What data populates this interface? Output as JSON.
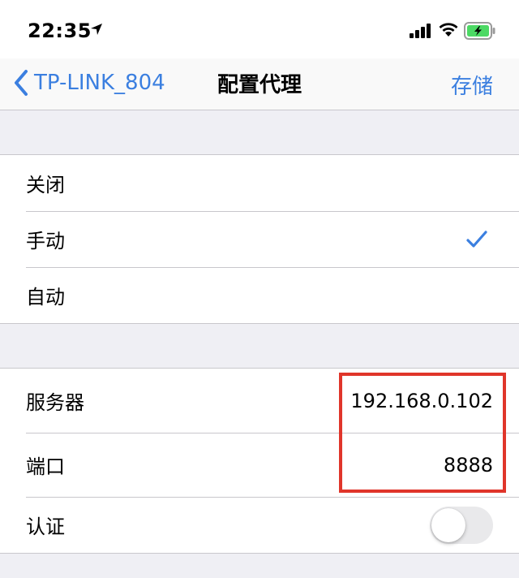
{
  "status_bar": {
    "time": "22:35"
  },
  "nav": {
    "back_label": "TP-LINK_804",
    "title": "配置代理",
    "save_label": "存储"
  },
  "proxy_modes": [
    {
      "label": "关闭",
      "selected": false
    },
    {
      "label": "手动",
      "selected": true
    },
    {
      "label": "自动",
      "selected": false
    }
  ],
  "server_settings": {
    "server_label": "服务器",
    "server_value": "192.168.0.102",
    "port_label": "端口",
    "port_value": "8888",
    "auth_label": "认证",
    "auth_enabled": false
  },
  "colors": {
    "accent": "#3b7fe0",
    "highlight": "#e0352a",
    "battery_charging": "#4cd964",
    "background": "#efeff4"
  },
  "icons": [
    "location-arrow-icon",
    "cellular-signal-icon",
    "wifi-icon",
    "battery-charging-icon",
    "back-chevron-icon",
    "checkmark-icon"
  ]
}
